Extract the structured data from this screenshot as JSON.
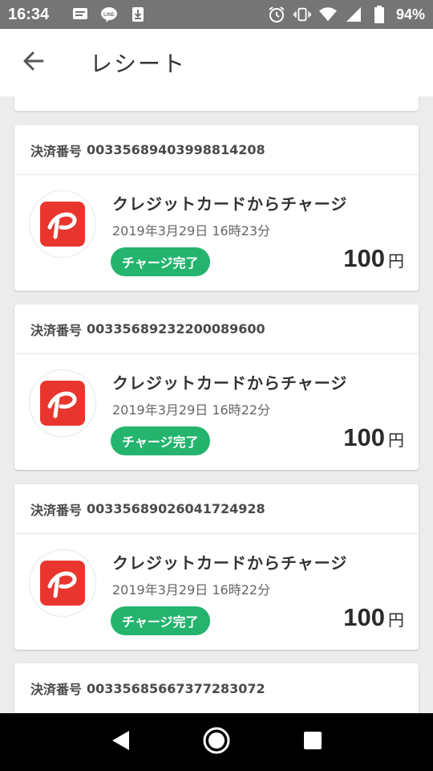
{
  "status_bar": {
    "time": "16:34",
    "battery": "94%",
    "left_icons": [
      "message-icon",
      "line-app-icon",
      "download-icon"
    ],
    "right_icons": [
      "alarm-icon",
      "vibrate-icon",
      "wifi-icon",
      "signal-icon",
      "battery-icon"
    ]
  },
  "app_bar": {
    "title": "レシート",
    "back_icon": "arrow-left-icon"
  },
  "colors": {
    "status_green": "#24b46e",
    "paypay_red": "#e8362e",
    "status_bar_bg": "#757575"
  },
  "receipts": [
    {
      "payment_label": "決済番号",
      "payment_number": "00335689403998814208",
      "title": "クレジットカードからチャージ",
      "datetime": "2019年3月29日 16時23分",
      "status": "チャージ完了",
      "amount": "100",
      "currency": "円"
    },
    {
      "payment_label": "決済番号",
      "payment_number": "00335689232200089600",
      "title": "クレジットカードからチャージ",
      "datetime": "2019年3月29日 16時22分",
      "status": "チャージ完了",
      "amount": "100",
      "currency": "円"
    },
    {
      "payment_label": "決済番号",
      "payment_number": "00335689026041724928",
      "title": "クレジットカードからチャージ",
      "datetime": "2019年3月29日 16時22分",
      "status": "チャージ完了",
      "amount": "100",
      "currency": "円"
    },
    {
      "payment_label": "決済番号",
      "payment_number": "00335685667377283072"
    }
  ],
  "nav_bar": {
    "buttons": [
      "back-triangle-icon",
      "home-circle-icon",
      "recents-square-icon"
    ]
  }
}
